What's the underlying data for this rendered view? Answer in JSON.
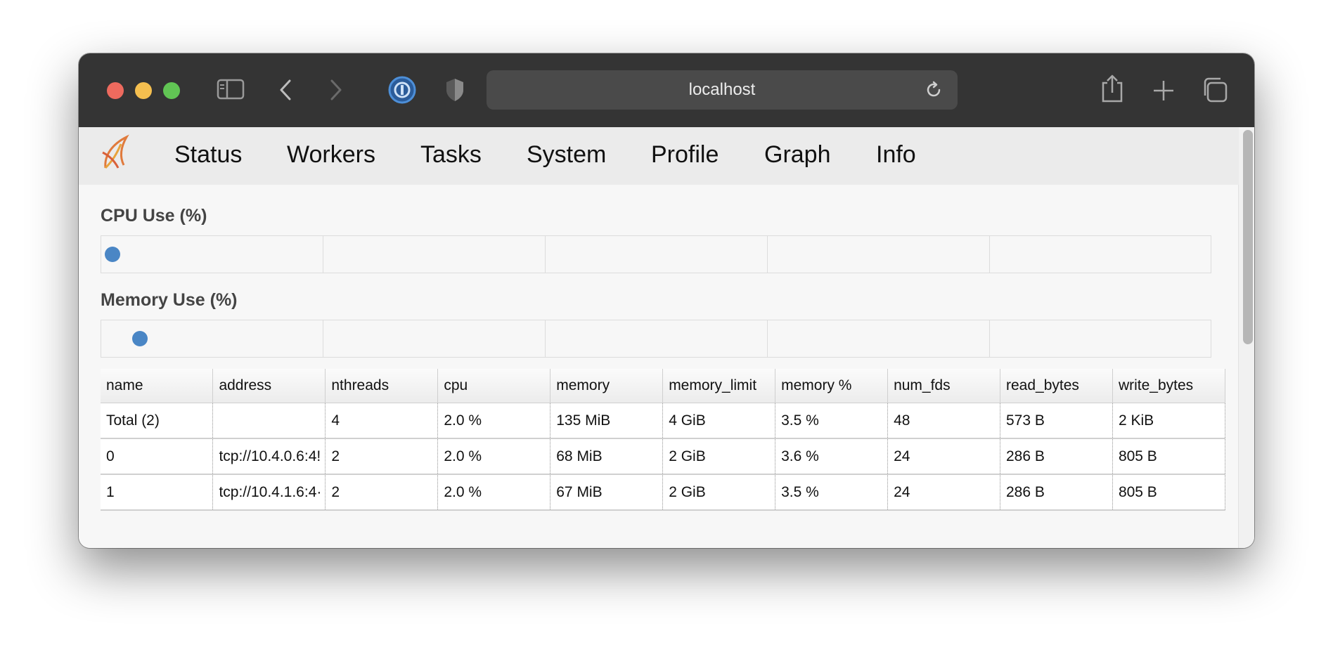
{
  "browser": {
    "url": "localhost",
    "icons": [
      "sidebar-icon",
      "back-icon",
      "forward-icon",
      "password-manager-icon",
      "privacy-shield-icon",
      "reload-icon",
      "share-icon",
      "new-tab-icon",
      "tabs-overview-icon"
    ]
  },
  "nav": {
    "items": [
      "Status",
      "Workers",
      "Tasks",
      "System",
      "Profile",
      "Graph",
      "Info"
    ]
  },
  "cpu_section": {
    "title": "CPU Use (%)",
    "points": [
      2.0,
      2.0
    ]
  },
  "memory_section": {
    "title": "Memory Use (%)",
    "points": [
      3.5,
      3.6,
      3.5
    ]
  },
  "table": {
    "columns": [
      "name",
      "address",
      "nthreads",
      "cpu",
      "memory",
      "memory_limit",
      "memory %",
      "num_fds",
      "read_bytes",
      "write_bytes"
    ],
    "rows": [
      [
        "Total (2)",
        "",
        "4",
        "2.0 %",
        "135 MiB",
        "4 GiB",
        "3.5 %",
        "48",
        "573 B",
        "2 KiB"
      ],
      [
        "0",
        "tcp://10.4.0.6:4!",
        "2",
        "2.0 %",
        "68 MiB",
        "2 GiB",
        "3.6 %",
        "24",
        "286 B",
        "805 B"
      ],
      [
        "1",
        "tcp://10.4.1.6:4·",
        "2",
        "2.0 %",
        "67 MiB",
        "2 GiB",
        "3.5 %",
        "24",
        "286 B",
        "805 B"
      ]
    ]
  },
  "colors": {
    "dot": "#4a86c5",
    "titlebar": "#343434"
  }
}
